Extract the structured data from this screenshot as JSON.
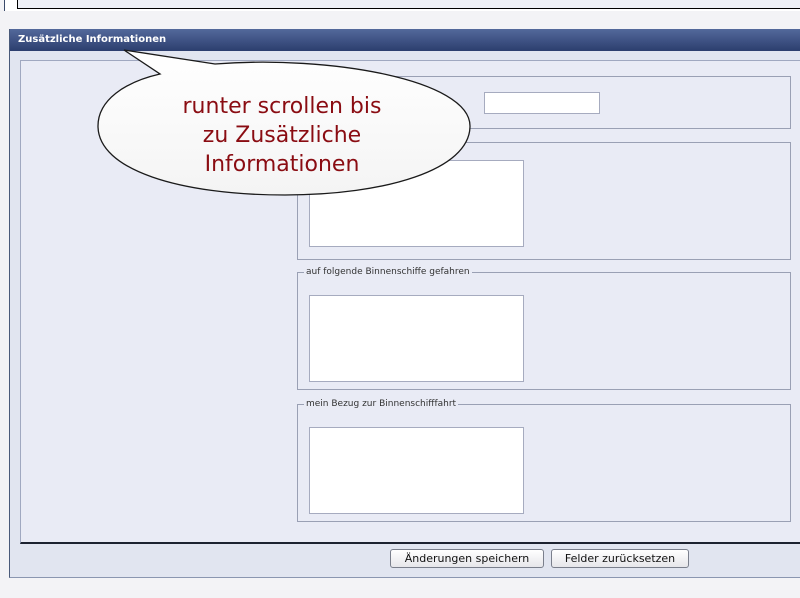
{
  "section": {
    "title": "Zusätzliche Informationen"
  },
  "fields": {
    "fieldset3_legend": "auf folgende Binnenschiffe gefahren",
    "fieldset4_legend": "mein Bezug zur Binnenschifffahrt"
  },
  "buttons": {
    "save_label": "Änderungen speichern",
    "reset_label": "Felder zurücksetzen"
  },
  "callout": {
    "text": "runter scrollen bis\nzu Zusätzliche\nInformationen",
    "color": "#8a0c12"
  },
  "colors": {
    "header": "#2c3e6e",
    "panel": "#e1e5f0"
  }
}
